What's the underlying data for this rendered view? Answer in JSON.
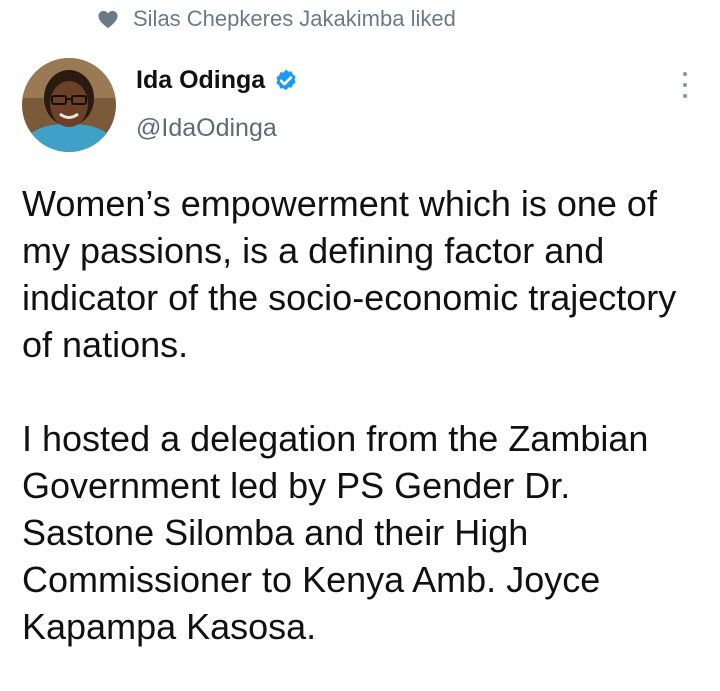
{
  "social_context": {
    "icon": "heart-icon",
    "text": "Silas Chepkeres Jakakimba liked"
  },
  "author": {
    "name": "Ida Odinga",
    "handle": "@IdaOdinga",
    "verified": true,
    "avatar": "profile-photo"
  },
  "menu": {
    "icon": "more-options-icon"
  },
  "tweet": {
    "paragraphs": [
      "Women’s empowerment which is one of my passions, is a defining factor and indicator of the socio-economic trajectory of nations.",
      "I hosted a delegation from the Zambian Government led by PS Gender Dr. Sastone Silomba and their High Commissioner to Kenya Amb. Joyce Kapampa Kasosa."
    ]
  },
  "colors": {
    "context_text": "#6b7a87",
    "verified_badge": "#1d9bf0",
    "handle_text": "#5e6b77"
  }
}
